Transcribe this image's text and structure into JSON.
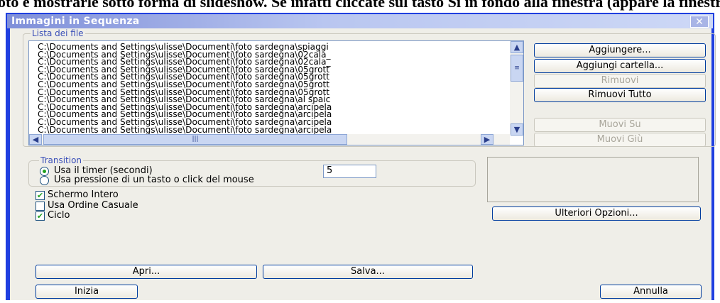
{
  "caption_line": "oto e mostrarle sotto forma di slideshow. Se infatti cliccate sul tasto Si in fondo alla finestra (appare la finestra) Immagini in sequenza",
  "window": {
    "title": "Immagini in Sequenza",
    "close_glyph": "✕"
  },
  "file_list": {
    "label": "Lista dei file",
    "rows": [
      "C:\\Documents and Settings\\ulisse\\Documenti\\foto sardegna\\spiaggi",
      "C:\\Documents and Settings\\ulisse\\Documenti\\foto sardegna\\02cala_",
      "C:\\Documents and Settings\\ulisse\\Documenti\\foto sardegna\\02cala_",
      "C:\\Documents and Settings\\ulisse\\Documenti\\foto sardegna\\05grott",
      "C:\\Documents and Settings\\ulisse\\Documenti\\foto sardegna\\05grott",
      "C:\\Documents and Settings\\ulisse\\Documenti\\foto sardegna\\05grott",
      "C:\\Documents and Settings\\ulisse\\Documenti\\foto sardegna\\05grott",
      "C:\\Documents and Settings\\ulisse\\Documenti\\foto sardegna\\al spaic",
      "C:\\Documents and Settings\\ulisse\\Documenti\\foto sardegna\\arcipela",
      "C:\\Documents and Settings\\ulisse\\Documenti\\foto sardegna\\arcipela",
      "C:\\Documents and Settings\\ulisse\\Documenti\\foto sardegna\\arcipela",
      "C:\\Documents and Settings\\ulisse\\Documenti\\foto sardegna\\arcipela"
    ],
    "scroll_up_glyph": "▲",
    "scroll_down_glyph": "▼",
    "scroll_left_glyph": "◀",
    "scroll_right_glyph": "▶"
  },
  "buttons": {
    "add": "Aggiungere...",
    "add_folder": "Aggiungi cartella...",
    "remove": "Rimuovi",
    "remove_all": "Rimuovi Tutto",
    "move_up": "Muovi Su",
    "move_down": "Muovi Giù",
    "more_options": "Ulteriori Opzioni...",
    "open": "Apri...",
    "save": "Salva...",
    "start": "Inizia",
    "cancel": "Annulla"
  },
  "transition": {
    "label": "Transition",
    "timer_option": "Usa il timer (secondi)",
    "timer_value": "5",
    "key_option": "Usa pressione di un tasto o click del mouse",
    "timer_selected": true
  },
  "options": {
    "fullscreen": {
      "label": "Schermo Intero",
      "checked": true
    },
    "random": {
      "label": "Usa Ordine Casuale",
      "checked": false
    },
    "loop": {
      "label": "Ciclo",
      "checked": true
    },
    "check_glyph": "✔"
  },
  "colors": {
    "window_border": "#1f3fe0",
    "group_label": "#3a4fb8",
    "check_green": "#21a121"
  }
}
